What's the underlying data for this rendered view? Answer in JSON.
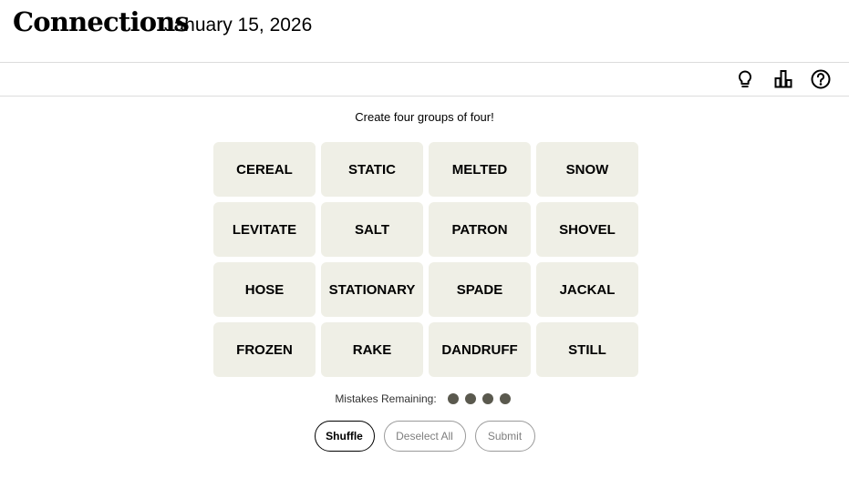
{
  "header": {
    "title": "Connections",
    "date": "January 15, 2026"
  },
  "toolbar": {
    "icons": [
      "hint-lightbulb-icon",
      "stats-bar-chart-icon",
      "help-question-icon"
    ]
  },
  "game": {
    "prompt": "Create four groups of four!",
    "tiles": [
      "CEREAL",
      "STATIC",
      "MELTED",
      "SNOW",
      "LEVITATE",
      "SALT",
      "PATRON",
      "SHOVEL",
      "HOSE",
      "STATIONARY",
      "SPADE",
      "JACKAL",
      "FROZEN",
      "RAKE",
      "DANDRUFF",
      "STILL"
    ],
    "mistakes_label": "Mistakes Remaining:",
    "mistakes_remaining": 4,
    "dot_color": "#5a594e",
    "tile_color": "#efefe6"
  },
  "buttons": {
    "shuffle": "Shuffle",
    "deselect": "Deselect All",
    "submit": "Submit"
  }
}
